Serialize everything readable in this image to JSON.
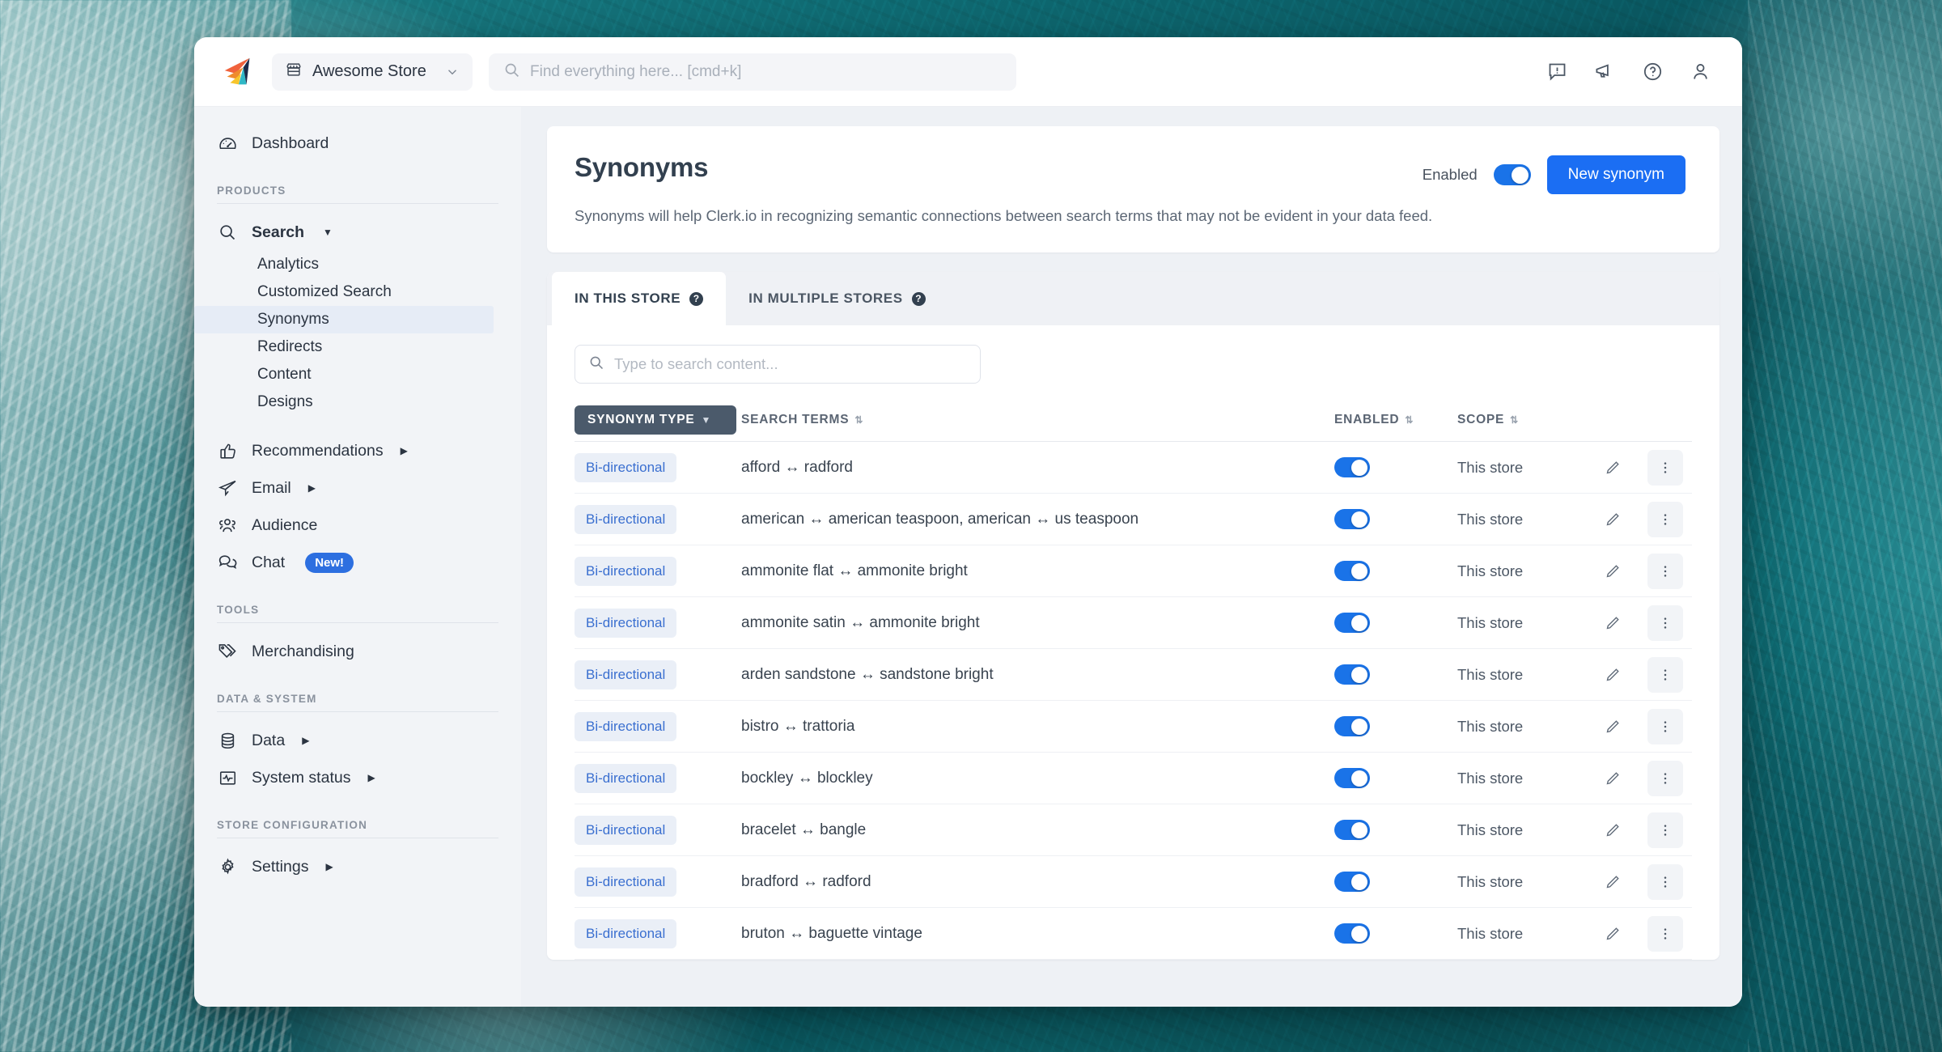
{
  "topbar": {
    "logo_icon": "clerkio-paperplane-logo",
    "store_selector": {
      "label": "Awesome Store",
      "icon": "store-icon",
      "chevron": "chevron-down-icon"
    },
    "omnisearch": {
      "placeholder": "Find everything here... [cmd+k]",
      "icon": "search-icon"
    },
    "actions": [
      {
        "name": "feedback-icon",
        "title": "Feedback"
      },
      {
        "name": "announcements-megaphone-icon",
        "title": "Announcements"
      },
      {
        "name": "help-question-icon",
        "title": "Help"
      },
      {
        "name": "user-account-icon",
        "title": "Account"
      }
    ]
  },
  "sidebar": {
    "dashboard": {
      "label": "Dashboard",
      "icon": "speedometer-icon"
    },
    "groups": [
      {
        "label": "PRODUCTS",
        "items": [
          {
            "label": "Search",
            "icon": "search-icon",
            "expanded": true,
            "caret": "caret-down",
            "children": [
              {
                "label": "Analytics",
                "active": false
              },
              {
                "label": "Customized Search",
                "active": false
              },
              {
                "label": "Synonyms",
                "active": true
              },
              {
                "label": "Redirects",
                "active": false
              },
              {
                "label": "Content",
                "active": false
              },
              {
                "label": "Designs",
                "active": false
              }
            ]
          },
          {
            "label": "Recommendations",
            "icon": "thumbs-up-icon",
            "caret": "caret-right"
          },
          {
            "label": "Email",
            "icon": "paper-plane-icon",
            "caret": "caret-right"
          },
          {
            "label": "Audience",
            "icon": "people-icon",
            "caret": ""
          },
          {
            "label": "Chat",
            "icon": "chat-bubbles-icon",
            "caret": "",
            "badge": "New!"
          }
        ]
      },
      {
        "label": "TOOLS",
        "items": [
          {
            "label": "Merchandising",
            "icon": "tag-icon",
            "caret": ""
          }
        ]
      },
      {
        "label": "DATA & SYSTEM",
        "items": [
          {
            "label": "Data",
            "icon": "database-icon",
            "caret": "caret-right"
          },
          {
            "label": "System status",
            "icon": "monitor-pulse-icon",
            "caret": "caret-right"
          }
        ]
      },
      {
        "label": "STORE CONFIGURATION",
        "items": [
          {
            "label": "Settings",
            "icon": "gear-icon",
            "caret": "caret-right"
          }
        ]
      }
    ]
  },
  "page": {
    "title": "Synonyms",
    "description": "Synonyms will help Clerk.io in recognizing semantic connections between search terms that may not be evident in your data feed.",
    "enabled_label": "Enabled",
    "enabled_state": true,
    "new_button": "New synonym"
  },
  "tabs": [
    {
      "label": "IN THIS STORE",
      "active": true,
      "help": "?"
    },
    {
      "label": "IN MULTIPLE STORES",
      "active": false,
      "help": "?"
    }
  ],
  "content_search": {
    "placeholder": "Type to search content...",
    "value": "",
    "icon": "search-icon"
  },
  "table": {
    "columns": {
      "type": "SYNONYM TYPE",
      "terms": "SEARCH TERMS",
      "enabled": "ENABLED",
      "scope": "SCOPE"
    },
    "sort_markers": {
      "type": "caret-down",
      "terms": "sort-updown",
      "enabled": "sort-updown",
      "scope": "sort-updown"
    },
    "rows": [
      {
        "type": "Bi-directional",
        "terms": "afford ↔ radford",
        "enabled": true,
        "scope": "This store"
      },
      {
        "type": "Bi-directional",
        "terms": "american ↔ american teaspoon, american ↔ us teaspoon",
        "enabled": true,
        "scope": "This store"
      },
      {
        "type": "Bi-directional",
        "terms": "ammonite flat ↔ ammonite bright",
        "enabled": true,
        "scope": "This store"
      },
      {
        "type": "Bi-directional",
        "terms": "ammonite satin ↔ ammonite bright",
        "enabled": true,
        "scope": "This store"
      },
      {
        "type": "Bi-directional",
        "terms": "arden sandstone ↔ sandstone bright",
        "enabled": true,
        "scope": "This store"
      },
      {
        "type": "Bi-directional",
        "terms": "bistro ↔ trattoria",
        "enabled": true,
        "scope": "This store"
      },
      {
        "type": "Bi-directional",
        "terms": "bockley ↔ blockley",
        "enabled": true,
        "scope": "This store"
      },
      {
        "type": "Bi-directional",
        "terms": "bracelet ↔ bangle",
        "enabled": true,
        "scope": "This store"
      },
      {
        "type": "Bi-directional",
        "terms": "bradford ↔ radford",
        "enabled": true,
        "scope": "This store"
      },
      {
        "type": "Bi-directional",
        "terms": "bruton ↔ baguette vintage",
        "enabled": true,
        "scope": "This store"
      }
    ],
    "row_actions": {
      "edit": "pencil-edit-icon",
      "more": "more-vertical-icon"
    }
  },
  "colors": {
    "accent_blue": "#1b6ef3",
    "toggle_on": "#1a73e8",
    "chip_text": "#3a6fd0",
    "chip_bg": "#eaeff7",
    "sidebar_bg": "#f2f4f7",
    "main_bg": "#eef1f5",
    "header_chip_bg": "#4b5a6b",
    "badge_new_bg": "#2d6fe0"
  }
}
